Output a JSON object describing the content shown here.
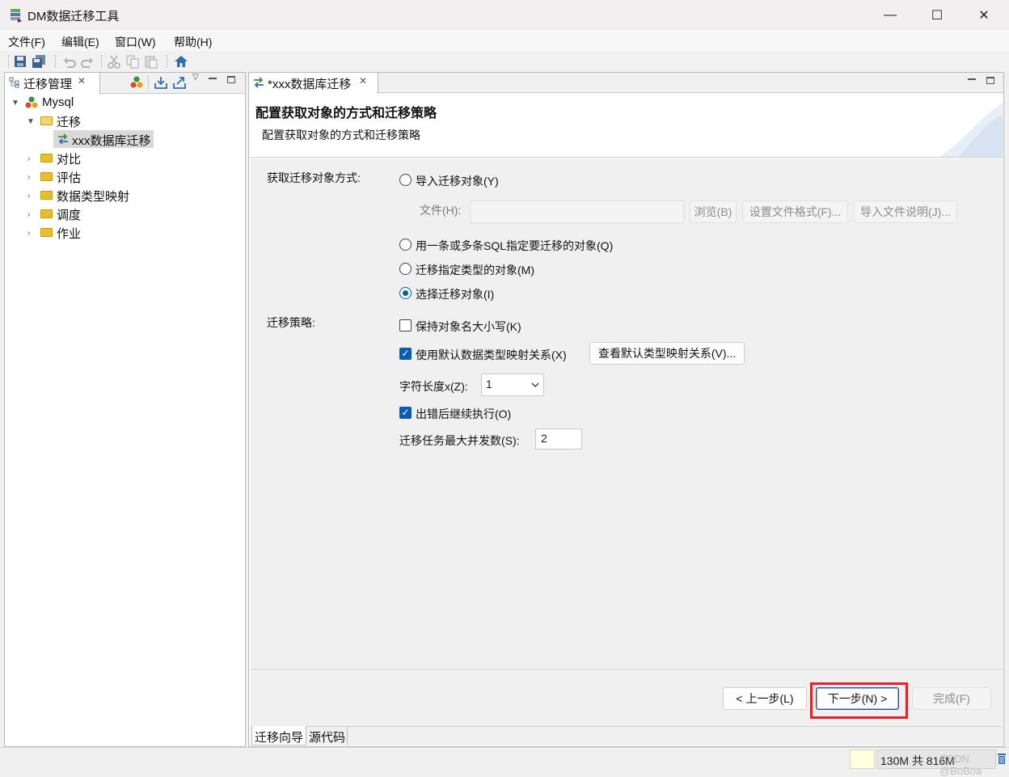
{
  "window": {
    "title": "DM数据迁移工具",
    "minimize": "—",
    "maximize": "☐",
    "close": "✕"
  },
  "menu": [
    "文件(F)",
    "编辑(E)",
    "窗口(W)",
    "帮助(H)"
  ],
  "left_panel": {
    "tab_label": "迁移管理",
    "tree": {
      "root": "Mysql",
      "migration": "迁移",
      "migration_child": "xxx数据库迁移",
      "others": [
        "对比",
        "评估",
        "数据类型映射",
        "调度",
        "作业"
      ]
    }
  },
  "editor": {
    "tab_label": "*xxx数据库迁移",
    "header_title": "配置获取对象的方式和迁移策略",
    "header_subtitle": "配置获取对象的方式和迁移策略",
    "acquire_label": "获取迁移对象方式:",
    "options": {
      "import": "导入迁移对象(Y)",
      "file_label": "文件(H):",
      "browse": "浏览(B)",
      "set_format": "设置文件格式(F)...",
      "import_help": "导入文件说明(J)...",
      "sql": "用一条或多条SQL指定要迁移的对象(Q)",
      "by_type": "迁移指定类型的对象(M)",
      "select": "选择迁移对象(I)",
      "selected": "select"
    },
    "strategy_label": "迁移策略:",
    "strategy": {
      "keep_case": "保持对象名大小写(K)",
      "keep_case_checked": false,
      "use_default_map": "使用默认数据类型映射关系(X)",
      "use_default_map_checked": true,
      "view_map": "查看默认类型映射关系(V)...",
      "char_len_label": "字符长度x(Z):",
      "char_len_value": "1",
      "continue_on_error": "出错后继续执行(O)",
      "continue_on_error_checked": true,
      "max_concurrency_label": "迁移任务最大并发数(S):",
      "max_concurrency_value": "2"
    },
    "buttons": {
      "prev": "< 上一步(L)",
      "next": "下一步(N) >",
      "finish": "完成(F)"
    },
    "bottom_tabs": [
      "迁移向导",
      "源代码"
    ]
  },
  "status": {
    "memory": "130M 共 816M",
    "watermark": "CSDN @BoBoa"
  }
}
